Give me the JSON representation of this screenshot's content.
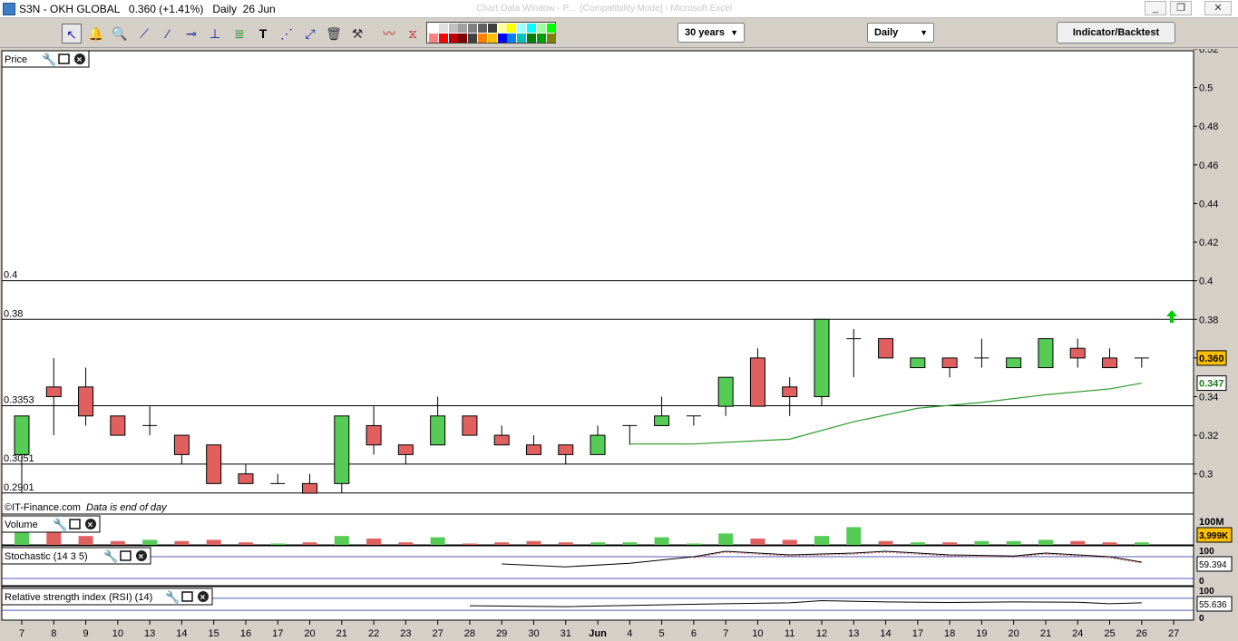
{
  "window": {
    "title": "S3N - OKH GLOBAL   0.360 (+1.41%)   Daily  26 Jun",
    "background_title": "Chart Data Window - P...  [Compatibility Mode] - Microsoft Excel",
    "controls": [
      "_",
      "❐",
      "✕"
    ]
  },
  "toolbar": {
    "period_select": "30 years",
    "interval_select": "Daily",
    "indicator_button": "Indicator/Backtest",
    "palette_colors": [
      "#ffffff",
      "#e0e0e0",
      "#c0c0c0",
      "#a0a0a0",
      "#808080",
      "#606060",
      "#404040",
      "#ffffa0",
      "#ffff00",
      "#a0ffff",
      "#00ffff",
      "#a0ffa0",
      "#00ff00",
      "#ff8080",
      "#ff0000",
      "#c00000",
      "#800000",
      "#404040",
      "#ff8000",
      "#ffc000",
      "#0000ff",
      "#0080ff",
      "#00c0c0",
      "#008000",
      "#00a000",
      "#808000"
    ]
  },
  "panels": {
    "price": {
      "title": "Price"
    },
    "volume": {
      "title": "Volume",
      "axis_top": "100M",
      "badge": "3,999K"
    },
    "stochastic": {
      "title": "Stochastic (14 3 5)",
      "axis_top": "100",
      "axis_bottom": "0",
      "badge": "59.394"
    },
    "rsi": {
      "title": "Relative strength index (RSI) (14)",
      "axis_top": "100",
      "axis_bottom": "0",
      "badge": "55.636"
    }
  },
  "footer_note": {
    "source": "©IT-Finance.com",
    "note": "Data is end of day"
  },
  "colors": {
    "up": "#55cc55",
    "down": "#e06060",
    "ma": "#2a9a2a",
    "badge_price": "#ffc000",
    "badge_other": "#ffffff",
    "arrow": "#00cc00"
  },
  "icons": [
    "pointer-icon",
    "alarm-bell-icon",
    "zoom-icon",
    "line-tool-icon",
    "ray-tool-icon",
    "horizontal-line-icon",
    "vertical-line-icon",
    "trend-tool-icon",
    "text-tool-icon",
    "fibonacci-icon",
    "channel-icon",
    "trash-icon",
    "tools-icon",
    "indicator-line-icon",
    "pattern-icon"
  ],
  "chart_data": {
    "type": "candlestick",
    "y_axis": {
      "min": 0.29,
      "max": 0.52,
      "ticks": [
        "0.52",
        "0.5",
        "0.48",
        "0.46",
        "0.44",
        "0.42",
        "0.4",
        "0.38",
        "0.36",
        "0.34",
        "0.32",
        "0.3"
      ]
    },
    "x_labels": [
      "7",
      "8",
      "9",
      "10",
      "13",
      "14",
      "15",
      "16",
      "17",
      "20",
      "21",
      "22",
      "23",
      "27",
      "28",
      "29",
      "30",
      "31",
      "Jun",
      "4",
      "5",
      "6",
      "7",
      "10",
      "11",
      "12",
      "13",
      "14",
      "17",
      "18",
      "19",
      "20",
      "21",
      "24",
      "25",
      "26",
      "27"
    ],
    "horizontal_lines": [
      {
        "value": 0.4,
        "label": "0.4"
      },
      {
        "value": 0.38,
        "label": "0.38"
      },
      {
        "value": 0.3353,
        "label": "0.3353"
      },
      {
        "value": 0.3051,
        "label": "0.3051"
      },
      {
        "value": 0.2901,
        "label": "0.2901"
      }
    ],
    "last_price_label": "0.360",
    "ma_label": "0.347",
    "candles": [
      {
        "o": 0.31,
        "h": 0.33,
        "l": 0.29,
        "c": 0.33
      },
      {
        "o": 0.345,
        "h": 0.36,
        "l": 0.32,
        "c": 0.34
      },
      {
        "o": 0.345,
        "h": 0.355,
        "l": 0.325,
        "c": 0.33
      },
      {
        "o": 0.33,
        "h": 0.33,
        "l": 0.32,
        "c": 0.32
      },
      {
        "o": 0.325,
        "h": 0.335,
        "l": 0.32,
        "c": 0.325
      },
      {
        "o": 0.32,
        "h": 0.32,
        "l": 0.305,
        "c": 0.31
      },
      {
        "o": 0.315,
        "h": 0.315,
        "l": 0.295,
        "c": 0.295
      },
      {
        "o": 0.3,
        "h": 0.305,
        "l": 0.295,
        "c": 0.295
      },
      {
        "o": 0.295,
        "h": 0.3,
        "l": 0.295,
        "c": 0.295
      },
      {
        "o": 0.295,
        "h": 0.3,
        "l": 0.29,
        "c": 0.29
      },
      {
        "o": 0.295,
        "h": 0.33,
        "l": 0.29,
        "c": 0.33
      },
      {
        "o": 0.325,
        "h": 0.335,
        "l": 0.31,
        "c": 0.315
      },
      {
        "o": 0.315,
        "h": 0.315,
        "l": 0.305,
        "c": 0.31
      },
      {
        "o": 0.315,
        "h": 0.34,
        "l": 0.315,
        "c": 0.33
      },
      {
        "o": 0.33,
        "h": 0.33,
        "l": 0.32,
        "c": 0.32
      },
      {
        "o": 0.32,
        "h": 0.325,
        "l": 0.315,
        "c": 0.315
      },
      {
        "o": 0.315,
        "h": 0.32,
        "l": 0.31,
        "c": 0.31
      },
      {
        "o": 0.315,
        "h": 0.315,
        "l": 0.305,
        "c": 0.31
      },
      {
        "o": 0.31,
        "h": 0.325,
        "l": 0.31,
        "c": 0.32
      },
      {
        "o": 0.325,
        "h": 0.325,
        "l": 0.315,
        "c": 0.325
      },
      {
        "o": 0.325,
        "h": 0.34,
        "l": 0.325,
        "c": 0.33
      },
      {
        "o": 0.33,
        "h": 0.33,
        "l": 0.325,
        "c": 0.33
      },
      {
        "o": 0.335,
        "h": 0.35,
        "l": 0.33,
        "c": 0.35
      },
      {
        "o": 0.36,
        "h": 0.365,
        "l": 0.335,
        "c": 0.335
      },
      {
        "o": 0.345,
        "h": 0.35,
        "l": 0.33,
        "c": 0.34
      },
      {
        "o": 0.34,
        "h": 0.38,
        "l": 0.335,
        "c": 0.38
      },
      {
        "o": 0.37,
        "h": 0.375,
        "l": 0.35,
        "c": 0.37
      },
      {
        "o": 0.37,
        "h": 0.37,
        "l": 0.36,
        "c": 0.36
      },
      {
        "o": 0.355,
        "h": 0.36,
        "l": 0.355,
        "c": 0.36
      },
      {
        "o": 0.36,
        "h": 0.36,
        "l": 0.35,
        "c": 0.355
      },
      {
        "o": 0.36,
        "h": 0.37,
        "l": 0.355,
        "c": 0.36
      },
      {
        "o": 0.355,
        "h": 0.36,
        "l": 0.355,
        "c": 0.36
      },
      {
        "o": 0.355,
        "h": 0.37,
        "l": 0.355,
        "c": 0.37
      },
      {
        "o": 0.365,
        "h": 0.37,
        "l": 0.355,
        "c": 0.36
      },
      {
        "o": 0.36,
        "h": 0.365,
        "l": 0.355,
        "c": 0.355
      },
      {
        "o": 0.36,
        "h": 0.36,
        "l": 0.355,
        "c": 0.36
      }
    ],
    "moving_average": [
      {
        "i": 19,
        "v": 0.3155
      },
      {
        "i": 21,
        "v": 0.3155
      },
      {
        "i": 24,
        "v": 0.318
      },
      {
        "i": 26,
        "v": 0.327
      },
      {
        "i": 28,
        "v": 0.334
      },
      {
        "i": 30,
        "v": 0.337
      },
      {
        "i": 32,
        "v": 0.341
      },
      {
        "i": 34,
        "v": 0.344
      },
      {
        "i": 35,
        "v": 0.347
      }
    ],
    "volume_rel": [
      0.9,
      0.85,
      0.35,
      0.15,
      0.2,
      0.15,
      0.2,
      0.1,
      0.05,
      0.1,
      0.35,
      0.25,
      0.1,
      0.3,
      0.05,
      0.1,
      0.15,
      0.1,
      0.1,
      0.1,
      0.3,
      0.05,
      0.45,
      0.25,
      0.2,
      0.35,
      0.7,
      0.15,
      0.1,
      0.1,
      0.15,
      0.15,
      0.2,
      0.15,
      0.1,
      0.1
    ],
    "stochastic": [
      {
        "i": 15,
        "v": 60
      },
      {
        "i": 17,
        "v": 52
      },
      {
        "i": 19,
        "v": 62
      },
      {
        "i": 21,
        "v": 80
      },
      {
        "i": 22,
        "v": 95
      },
      {
        "i": 24,
        "v": 85
      },
      {
        "i": 26,
        "v": 90
      },
      {
        "i": 27,
        "v": 95
      },
      {
        "i": 29,
        "v": 85
      },
      {
        "i": 31,
        "v": 82
      },
      {
        "i": 32,
        "v": 90
      },
      {
        "i": 34,
        "v": 80
      },
      {
        "i": 35,
        "v": 65
      }
    ],
    "rsi": [
      {
        "i": 14,
        "v": 45
      },
      {
        "i": 17,
        "v": 42
      },
      {
        "i": 20,
        "v": 48
      },
      {
        "i": 22,
        "v": 52
      },
      {
        "i": 24,
        "v": 55
      },
      {
        "i": 25,
        "v": 62
      },
      {
        "i": 27,
        "v": 58
      },
      {
        "i": 29,
        "v": 56
      },
      {
        "i": 31,
        "v": 58
      },
      {
        "i": 33,
        "v": 57
      },
      {
        "i": 34,
        "v": 52
      },
      {
        "i": 35,
        "v": 55
      }
    ]
  }
}
